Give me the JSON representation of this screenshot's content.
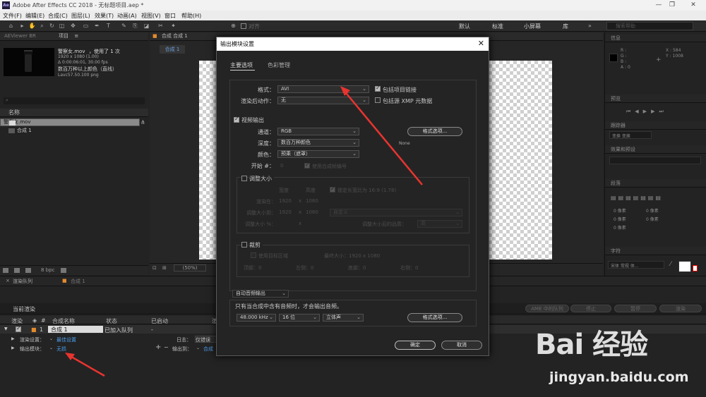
{
  "window": {
    "title": "Adobe After Effects CC 2018 - 无标题项目.aep *",
    "logo_text": "Ae"
  },
  "menu": [
    "文件(F)",
    "编辑(E)",
    "合成(C)",
    "图层(L)",
    "效果(T)",
    "动画(A)",
    "视图(V)",
    "窗口",
    "帮助(H)"
  ],
  "toolbar": {
    "snap_label": "对齐",
    "workspaces": [
      "默认",
      "标准",
      "小屏幕",
      "库"
    ],
    "search_placeholder": "搜索帮助"
  },
  "project_panel": {
    "tab_left": "AEViewer BR",
    "tab_project": "项目",
    "clip_name": "警察女.mov",
    "clip_used": "，使用了 1 次",
    "clip_meta": [
      "1920 x 1080 (1.00)",
      "Δ 0:00:06:01, 30.00 fps",
      "数百万种以上颜色（直线）",
      "Lavc57.50.100 png"
    ],
    "column_name": "名称",
    "items": [
      {
        "name": "警察女.mov",
        "selected": true
      },
      {
        "name": "合成 1",
        "selected": false
      }
    ],
    "bpc": "8 bpc"
  },
  "viewer": {
    "tab_comp": "合成 合成 1",
    "comp_tab": "合成 1",
    "zoom": "(50%)"
  },
  "right_panels": {
    "info": "信息",
    "preview": "预览",
    "tracker": "跟踪器",
    "tracker_value": "变换 变换",
    "effects": "效果和预设",
    "paragraph": "段落",
    "character": "字符",
    "font": "宋体 常规 体...",
    "info_r": "R :",
    "info_g": "G :",
    "info_b": "B :",
    "info_a": "A : 0",
    "info_x": "X : 584",
    "info_y": "Y : 1008",
    "para_vals": [
      "0 像素",
      "0 像素",
      "0 像素",
      "0 像素",
      "0 像素"
    ]
  },
  "render_queue": {
    "tab_queue": "渲染队列",
    "tab_comp": "合成 1",
    "current_render": "当前渲染",
    "buttons": [
      "AME 中的队列",
      "停止",
      "暂停",
      "渲染"
    ],
    "headers": [
      "渲染",
      "#",
      "合成名称",
      "状态",
      "已启动",
      "渲"
    ],
    "item": {
      "index": "1",
      "comp": "合成 1",
      "status": "已加入队列",
      "started": "-"
    },
    "render_settings_label": "渲染设置：",
    "render_settings_value": "最佳设置",
    "output_module_label": "输出模块：",
    "output_module_value": "无损",
    "log_label": "日志：",
    "log_value": "仅错误",
    "output_to_label": "输出到：",
    "output_to_value": "合成"
  },
  "dialog": {
    "title": "输出模块设置",
    "tabs": [
      "主要选项",
      "色彩管理"
    ],
    "format_label": "格式：",
    "format_value": "AVI",
    "post_render_label": "渲染后动作：",
    "post_render_value": "无",
    "include_project_link": "包括项目链接",
    "include_xmp": "包括源 XMP 元数据",
    "video_output": "视频输出",
    "channels_label": "通道：",
    "channels_value": "RGB",
    "depth_label": "深度：",
    "depth_value": "数百万种颜色",
    "color_label": "颜色：",
    "color_value": "预乘（遮罩）",
    "start_label": "开始 #：",
    "start_value": "0",
    "use_comp_frame": "使用合成帧编号",
    "format_options": "格式选项...",
    "codec_info": "None",
    "resize": "调整大小",
    "resize_width": "宽度",
    "resize_height": "高度",
    "lock_aspect": "锁定长宽比为 16:9 (1.78)",
    "render_at_label": "渲染在：",
    "render_at_w": "1920",
    "render_at_h": "1080",
    "resize_to_label": "调整大小到：",
    "resize_to_w": "1920",
    "resize_to_h": "1080",
    "resize_custom": "自定义",
    "resize_pct_label": "调整大小 %：",
    "resize_quality_label": "调整大小后的品质：",
    "resize_quality_value": "高",
    "crop": "裁剪",
    "use_roi": "使用目标区域",
    "final_size": "最终大小：1920 x 1080",
    "crop_top": "顶部：0",
    "crop_left": "左侧：0",
    "crop_bottom": "底部：0",
    "crop_right": "右侧：0",
    "audio_output": "自动音频输出",
    "audio_note": "只有当合成中含有音频时，才会输出音频。",
    "audio_rate": "48.000 kHz",
    "audio_bits": "16 位",
    "audio_channels": "立体声",
    "audio_format_options": "格式选项...",
    "ok": "确定",
    "cancel": "取消"
  },
  "watermark": {
    "logo": "Bai 经验",
    "url": "jingyan.baidu.com"
  },
  "colors": {
    "accent_link": "#4d9ce8",
    "annotation_red": "#e8342f"
  }
}
